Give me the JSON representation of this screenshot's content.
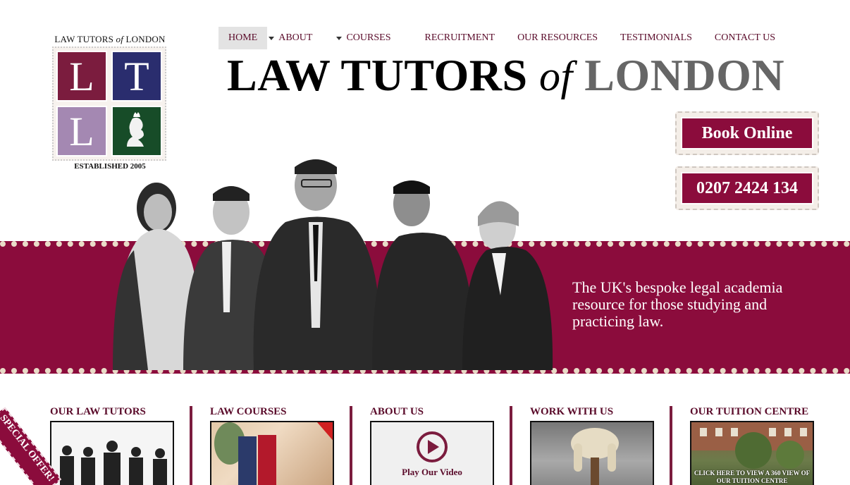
{
  "logo": {
    "top_text_prefix": "LAW TUTORS ",
    "top_text_of": "of",
    "top_text_suffix": " LONDON",
    "tiles": [
      "L",
      "T",
      "L"
    ],
    "established": "ESTABLISHED 2005"
  },
  "nav": {
    "items": [
      {
        "label": "HOME",
        "active": true,
        "dropdown": false
      },
      {
        "label": "ABOUT",
        "active": false,
        "dropdown": true
      },
      {
        "label": "COURSES",
        "active": false,
        "dropdown": true
      },
      {
        "label": "RECRUITMENT",
        "active": false,
        "dropdown": false
      },
      {
        "label": "OUR RESOURCES",
        "active": false,
        "dropdown": false
      },
      {
        "label": "TESTIMONIALS",
        "active": false,
        "dropdown": false
      },
      {
        "label": "CONTACT US",
        "active": false,
        "dropdown": false
      }
    ]
  },
  "headline": {
    "part1": "LAW TUTORS ",
    "part2": "of",
    "part3": " LONDON"
  },
  "buttons": {
    "book": "Book Online",
    "phone": "0207 2424 134"
  },
  "banner": {
    "text": "The UK's bespoke legal academia resource for those studying and practicing law."
  },
  "sections": [
    {
      "title": "OUR LAW TUTORS"
    },
    {
      "title": "LAW COURSES"
    },
    {
      "title": "ABOUT US",
      "cta": "Play Our Video"
    },
    {
      "title": "WORK WITH US"
    },
    {
      "title": "OUR TUITION CENTRE",
      "caption": "CLICK HERE TO VIEW A 360 VIEW OF OUR TUITION CENTRE"
    }
  ],
  "ribbon": {
    "text": "SPECIAL OFFER!"
  },
  "colors": {
    "brand": "#8b0c3c",
    "nav_text": "#5a0b2a",
    "navy_tile": "#2a2d6e",
    "lilac_tile": "#a488b2",
    "green_tile": "#174c28"
  }
}
